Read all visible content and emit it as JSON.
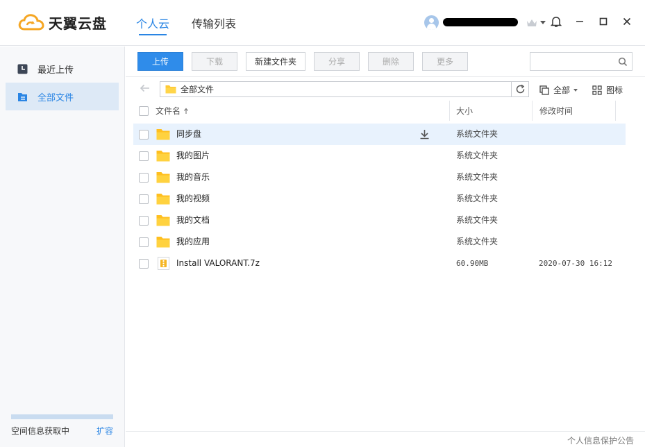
{
  "app": {
    "logo_text": "天翼云盘",
    "brand_color": "#f5a623",
    "accent_color": "#2a85e4"
  },
  "header": {
    "tabs": [
      {
        "label": "个人云",
        "active": true
      },
      {
        "label": "传输列表",
        "active": false
      }
    ],
    "user": {
      "name_redacted": true,
      "icons": [
        "avatar-icon",
        "crown-icon",
        "chevron-down-icon"
      ]
    },
    "window_controls": [
      "bell-icon",
      "minimize-icon",
      "maximize-icon",
      "close-icon"
    ]
  },
  "sidebar": {
    "items": [
      {
        "label": "最近上传",
        "icon": "clock-icon",
        "active": false
      },
      {
        "label": "全部文件",
        "icon": "files-icon",
        "active": true
      }
    ],
    "quota_text": "空间信息获取中",
    "expand_label": "扩容"
  },
  "toolbar": {
    "buttons": [
      {
        "label": "上传",
        "state": "primary"
      },
      {
        "label": "下载",
        "state": "disabled"
      },
      {
        "label": "新建文件夹",
        "state": "enabled"
      },
      {
        "label": "分享",
        "state": "disabled"
      },
      {
        "label": "删除",
        "state": "disabled"
      },
      {
        "label": "更多",
        "state": "disabled"
      }
    ],
    "search": {
      "value": "",
      "placeholder": ""
    }
  },
  "pathbar": {
    "path": "全部文件",
    "filter_label": "全部",
    "view_label": "图标"
  },
  "table": {
    "columns": {
      "name": "文件名",
      "size": "大小",
      "modified": "修改时间"
    },
    "rows": [
      {
        "name": "同步盘",
        "type": "folder",
        "size": "系统文件夹",
        "modified": "",
        "hover": true
      },
      {
        "name": "我的图片",
        "type": "folder",
        "size": "系统文件夹",
        "modified": ""
      },
      {
        "name": "我的音乐",
        "type": "folder",
        "size": "系统文件夹",
        "modified": ""
      },
      {
        "name": "我的视频",
        "type": "folder",
        "size": "系统文件夹",
        "modified": ""
      },
      {
        "name": "我的文档",
        "type": "folder",
        "size": "系统文件夹",
        "modified": ""
      },
      {
        "name": "我的应用",
        "type": "folder",
        "size": "系统文件夹",
        "modified": ""
      },
      {
        "name": "Install VALORANT.7z",
        "type": "archive",
        "size": "60.90MB",
        "modified": "2020-07-30 16:12"
      }
    ]
  },
  "footer": {
    "privacy_link": "个人信息保护公告"
  }
}
